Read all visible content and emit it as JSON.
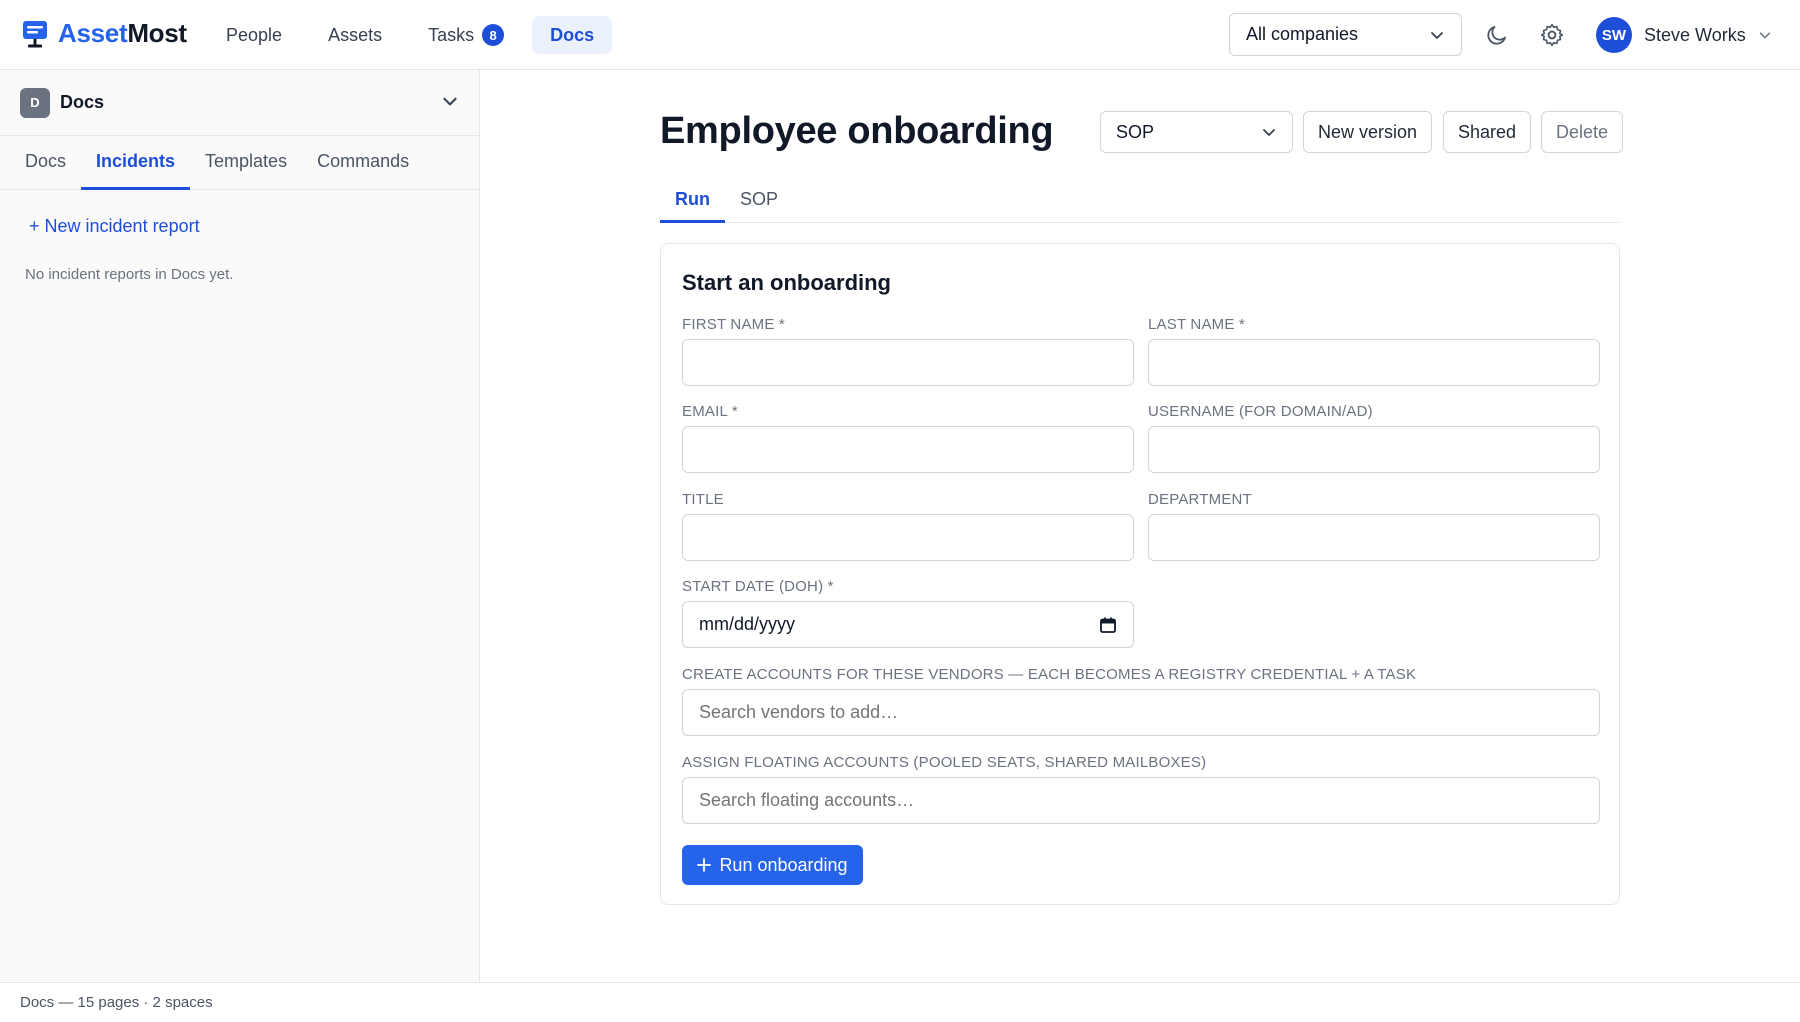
{
  "app": {
    "brand_part1": "Asset",
    "brand_part2": "Most",
    "nav": [
      {
        "label": "People"
      },
      {
        "label": "Assets"
      },
      {
        "label": "Tasks",
        "badge": "8"
      },
      {
        "label": "Docs",
        "active": true
      }
    ],
    "company_select": "All companies",
    "user": {
      "initials": "SW",
      "name": "Steve Works"
    }
  },
  "sidebar": {
    "space_initial": "D",
    "space_name": "Docs",
    "tabs": [
      "Docs",
      "Incidents",
      "Templates",
      "Commands"
    ],
    "active_tab": "Incidents",
    "new_incident": "+ New incident report",
    "empty_note": "No incident reports in Docs yet."
  },
  "footer": {
    "text": "Docs — 15 pages · 2 spaces"
  },
  "page": {
    "title": "Employee onboarding",
    "mode_select": "SOP",
    "actions": {
      "new_version": "New version",
      "shared": "Shared",
      "delete": "Delete"
    },
    "tabs": [
      "Run",
      "SOP"
    ],
    "active_tab": "Run"
  },
  "form": {
    "title": "Start an onboarding",
    "fields": {
      "first_name": {
        "label": "FIRST NAME *",
        "value": ""
      },
      "last_name": {
        "label": "LAST NAME *",
        "value": ""
      },
      "email": {
        "label": "EMAIL *",
        "value": ""
      },
      "username": {
        "label": "USERNAME (FOR DOMAIN/AD)",
        "value": ""
      },
      "title": {
        "label": "TITLE",
        "value": ""
      },
      "department": {
        "label": "DEPARTMENT",
        "value": ""
      },
      "start_date": {
        "label": "START DATE (DOH) *",
        "value": "mm/dd/yyyy"
      },
      "vendors": {
        "label": "CREATE ACCOUNTS FOR THESE VENDORS — EACH BECOMES A REGISTRY CREDENTIAL + A TASK",
        "placeholder": "Search vendors to add…"
      },
      "floating": {
        "label": "ASSIGN FLOATING ACCOUNTS (POOLED SEATS, SHARED MAILBOXES)",
        "placeholder": "Search floating accounts…"
      }
    },
    "submit": "Run onboarding"
  },
  "colors": {
    "accent": "#2563eb",
    "accent_dark": "#1d4ed8",
    "border": "#e5e7eb",
    "muted_text": "#6b7280"
  },
  "icons": [
    "monitor-logo-icon",
    "chevron-down-icon",
    "moon-icon",
    "gear-icon",
    "calendar-icon",
    "plus-icon"
  ]
}
